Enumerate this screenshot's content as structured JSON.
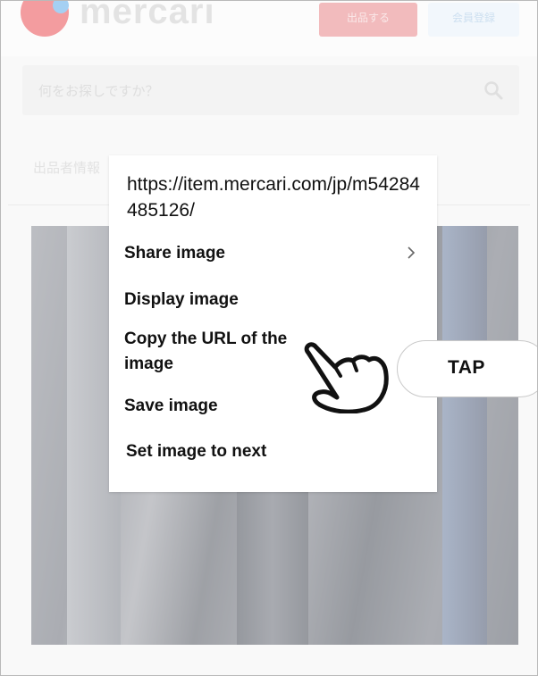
{
  "background_page": {
    "logo_text": "mercari",
    "sell_button_label": "出品する",
    "login_button_label": "会員登録",
    "search_placeholder": "何をお探しですか？",
    "sub_row_text": "出品者情報",
    "colors": {
      "logo_red": "#e8393f",
      "logo_blue": "#4aa3e8",
      "sell_button": "#e98a8e",
      "login_button": "#e8f2fa"
    }
  },
  "context_menu": {
    "url": "https://item.mercari.com/jp/m54284485126/",
    "items": [
      {
        "label": "Share image",
        "has_submenu": true
      },
      {
        "label": "Display image",
        "has_submenu": false
      },
      {
        "label": "Copy the URL of the image",
        "has_submenu": false
      },
      {
        "label": "Save image",
        "has_submenu": false
      },
      {
        "label": "Set image to next",
        "has_submenu": false
      }
    ]
  },
  "annotation": {
    "tap_label": "TAP",
    "pointer_icon": "hand-pointer-icon",
    "points_to": "Copy the URL of the image"
  }
}
